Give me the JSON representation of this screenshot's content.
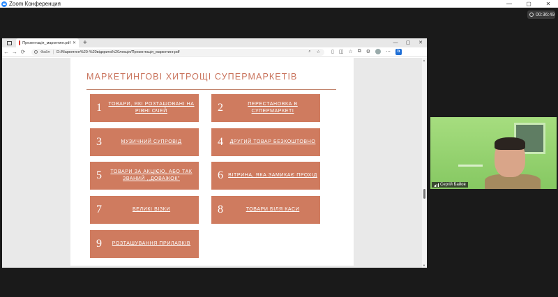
{
  "zoom": {
    "window_title": "Zoom Конференция",
    "win_controls": [
      "—",
      "▢",
      "✕"
    ],
    "timer": "00:36:49"
  },
  "browser": {
    "tab_label": "Презентація_маркетинг.pdf",
    "tab_close": "✕",
    "new_tab": "+",
    "win_controls": [
      "—",
      "▢",
      "✕"
    ],
    "nav": [
      "←",
      "→",
      "⟳"
    ],
    "address_prefix": "Файл",
    "url": "D:/Маркетинг%20-%20відкрита%20лекція/Презентація_маркетинг.pdf"
  },
  "slide": {
    "title": "МАРКЕТИНГОВІ ХИТРОЩІ СУПЕРМАРКЕТІВ",
    "cards": [
      {
        "num": "1",
        "text": "ТОВАРИ, ЯКІ РОЗТАШОВАНІ НА РІВНІ ОЧЕЙ"
      },
      {
        "num": "2",
        "text": "ПЕРЕСТАНОВКА В СУПЕРМАРКЕТІ"
      },
      {
        "num": "3",
        "text": "МУЗИЧНИЙ СУПРОВІД"
      },
      {
        "num": "4",
        "text": "ДРУГИЙ ТОВАР БЕЗКОШТОВНО"
      },
      {
        "num": "5",
        "text": "ТОВАРИ ЗА АКЦІЄЮ, АБО ТАК ЗВАНИЙ ,,ДОВАЖОК”"
      },
      {
        "num": "6",
        "text": "ВІТРИНА, ЯКА ЗАМИКАЄ ПРОХІД"
      },
      {
        "num": "7",
        "text": "ВЕЛИКІ ВІЗКИ"
      },
      {
        "num": "8",
        "text": "ТОВАРИ БІЛЯ КАСИ"
      },
      {
        "num": "9",
        "text": "РОЗТАШУВАННЯ ПРИЛАВКІВ"
      }
    ]
  },
  "participant": {
    "name": "Сергій Байов"
  }
}
